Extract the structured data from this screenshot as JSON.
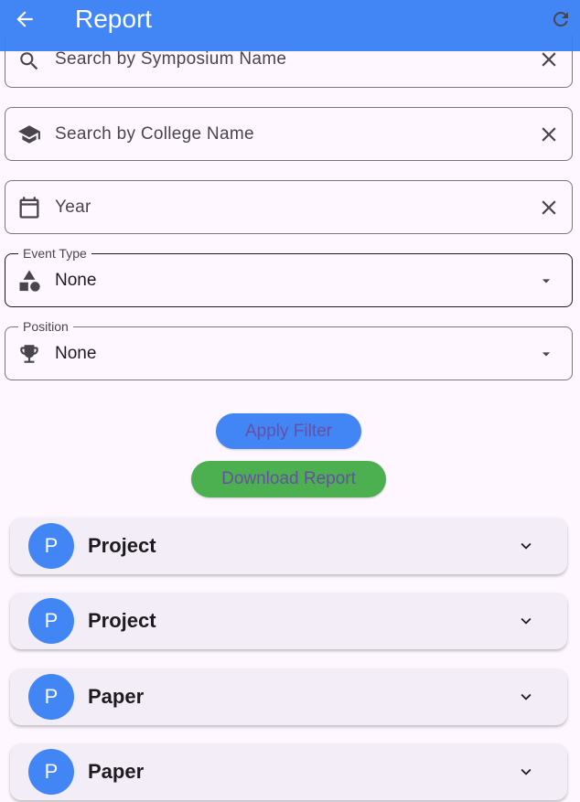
{
  "app_bar": {
    "title": "Report",
    "back_icon": "arrow-back-icon",
    "refresh_icon": "refresh-icon",
    "color": "#4285F4"
  },
  "filters": {
    "symposium": {
      "placeholder": "Search by Symposium Name",
      "icon": "search-icon"
    },
    "college": {
      "placeholder": "Search by College Name",
      "icon": "school-icon"
    },
    "year": {
      "placeholder": "Year",
      "icon": "calendar-icon"
    },
    "event_type": {
      "label": "Event Type",
      "value": "None",
      "icon": "category-icon"
    },
    "position": {
      "label": "Position",
      "value": "None",
      "icon": "trophy-icon"
    }
  },
  "actions": {
    "apply_label": "Apply Filter",
    "download_label": "Download Report"
  },
  "results": [
    {
      "initial": "P",
      "title": "Project"
    },
    {
      "initial": "P",
      "title": "Project"
    },
    {
      "initial": "P",
      "title": "Paper"
    },
    {
      "initial": "P",
      "title": "Paper"
    }
  ]
}
